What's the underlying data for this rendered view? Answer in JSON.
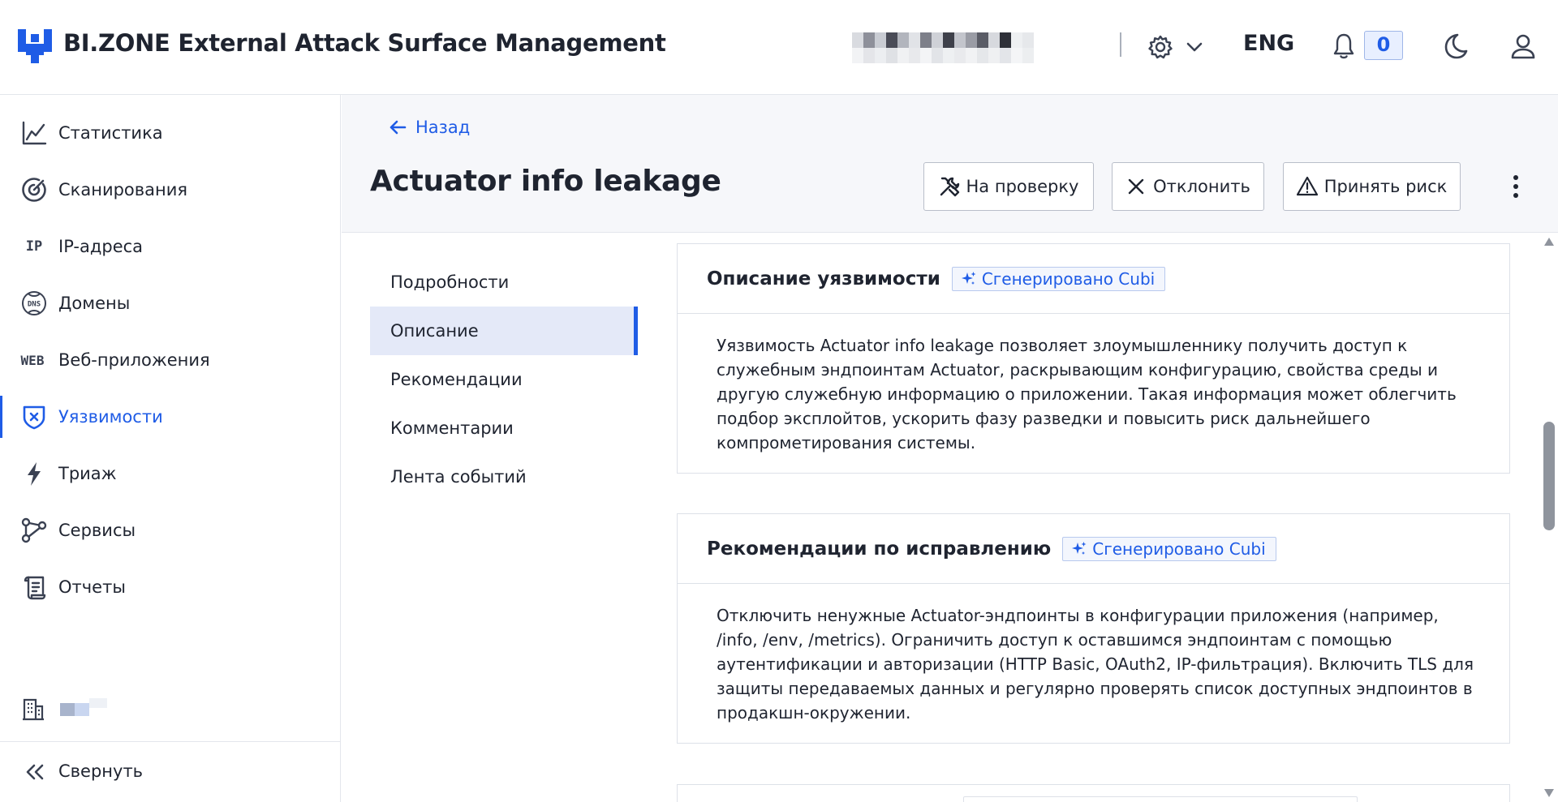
{
  "header": {
    "app_title": "BI.ZONE External Attack Surface Management",
    "language": "ENG",
    "notifications_count": "0"
  },
  "sidebar": {
    "items": [
      {
        "label": "Статистика",
        "icon": "chart-line-icon"
      },
      {
        "label": "Сканирования",
        "icon": "target-icon"
      },
      {
        "label": "IP-адреса",
        "icon": "ip-icon",
        "icon_text": "IP"
      },
      {
        "label": "Домены",
        "icon": "dns-globe-icon"
      },
      {
        "label": "Веб-приложения",
        "icon": "web-icon",
        "icon_text": "WEB"
      },
      {
        "label": "Уязвимости",
        "icon": "shield-x-icon",
        "active": true
      },
      {
        "label": "Триаж",
        "icon": "lightning-icon"
      },
      {
        "label": "Сервисы",
        "icon": "services-graph-icon"
      },
      {
        "label": "Отчеты",
        "icon": "report-scroll-icon"
      }
    ],
    "collapse_label": "Свернуть"
  },
  "page": {
    "back_label": "Назад",
    "title": "Actuator info leakage",
    "actions": {
      "review": "На проверку",
      "reject": "Отклонить",
      "accept_risk": "Принять риск"
    }
  },
  "toc": {
    "items": [
      {
        "label": "Подробности"
      },
      {
        "label": "Описание",
        "active": true
      },
      {
        "label": "Рекомендации"
      },
      {
        "label": "Комментарии"
      },
      {
        "label": "Лента событий"
      }
    ]
  },
  "sections": {
    "description": {
      "title": "Описание уязвимости",
      "badge": "Сгенерировано Cubi",
      "text": "Уязвимость Actuator info leakage позволяет злоумышленнику получить доступ к служебным эндпоинтам Actuator, раскрывающим конфигурацию, свойства среды и другую служебную информацию о приложении. Такая информация может облегчить подбор эксплойтов, ускорить фазу разведки и повысить риск дальнейшего компрометирования системы."
    },
    "recommendations": {
      "title": "Рекомендации по исправлению",
      "badge": "Сгенерировано Cubi",
      "text": "Отключить ненужные Actuator-эндпоинты в конфигурации приложения (например, /info, /env, /metrics). Ограничить доступ к оставшимся эндпоинтам с помощью аутентификации и авторизации (HTTP Basic, OAuth2, IP-фильтрация). Включить TLS для защиты передаваемых данных и регулярно проверять список доступных эндпоинтов в продакшн-окружении."
    }
  },
  "colors": {
    "accent": "#1f5ce6",
    "active_bg": "#e4e9f8",
    "text": "#1f2430",
    "border": "#dde1e8"
  }
}
